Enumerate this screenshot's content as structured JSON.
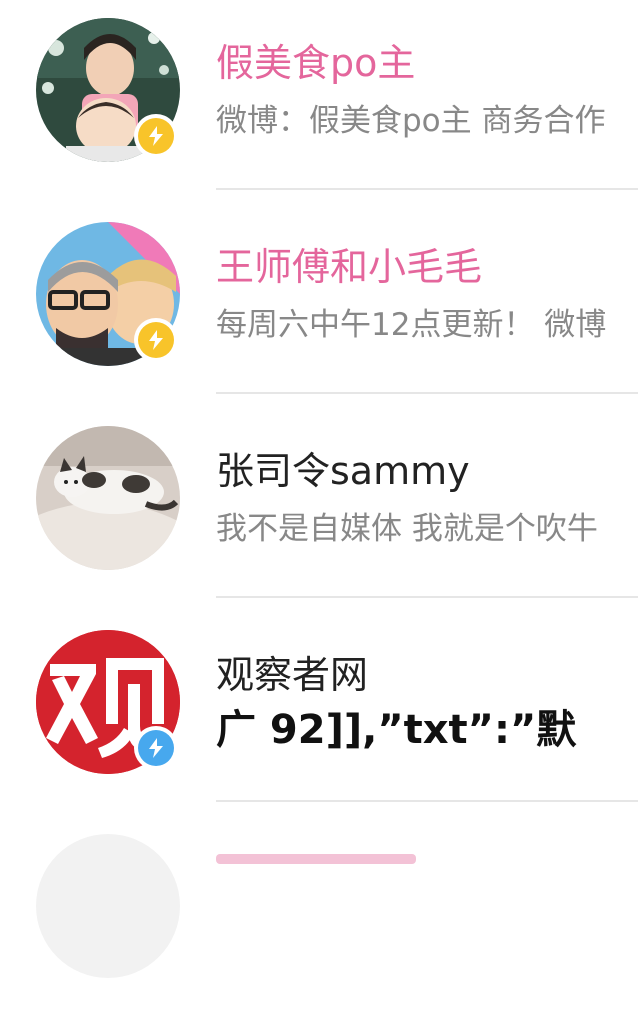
{
  "accounts": [
    {
      "name": "假美食po主",
      "desc": "微博：假美食po主 商务合作",
      "name_color": "pink",
      "badge": "yellow",
      "badge_icon": "lightning-icon",
      "avatar_subject": "two children"
    },
    {
      "name": "王师傅和小毛毛",
      "desc": "每周六中午12点更新！  微博",
      "name_color": "pink",
      "badge": "yellow",
      "badge_icon": "lightning-icon",
      "avatar_subject": "cartoon men"
    },
    {
      "name": "张司令sammy",
      "desc": "我不是自媒体 我就是个吹牛",
      "name_color": "black",
      "badge": null,
      "avatar_subject": "cat on bed"
    },
    {
      "name": "观察者网",
      "desc": "广    92]],”txt”:”默",
      "name_color": "black",
      "badge": "blue",
      "badge_icon": "lightning-icon",
      "avatar_subject": "观 logo"
    }
  ],
  "colors": {
    "pink": "#e4669c",
    "yellow_badge": "#f8c42a",
    "blue_badge": "#47a8ee",
    "divider": "#e6e6e6"
  }
}
